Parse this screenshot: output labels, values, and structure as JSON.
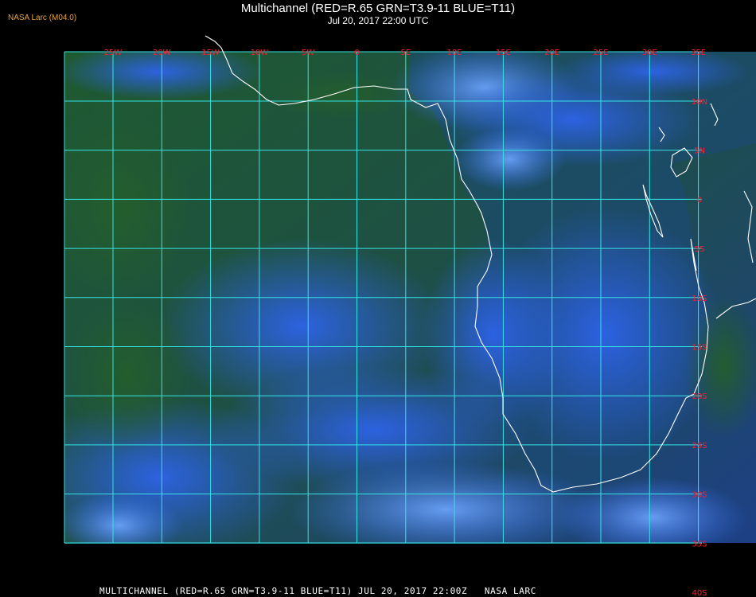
{
  "header": {
    "brand": "NASA Larc (M04.0)",
    "title": "Multichannel (RED=R.65 GRN=T3.9-11 BLUE=T11)",
    "subtitle": "Jul 20, 2017 22:00 UTC"
  },
  "map": {
    "longitude_labels": [
      "25W",
      "20W",
      "15W",
      "10W",
      "5W",
      "0",
      "5E",
      "10E",
      "15E",
      "20E",
      "25E",
      "30E",
      "35E"
    ],
    "latitude_labels": [
      "10N",
      "5N",
      "0",
      "5S",
      "10S",
      "15S",
      "20S",
      "25S",
      "30S",
      "35S",
      "40S"
    ],
    "grid_color": "#33e5e5",
    "label_color": "#ff1f2e",
    "coastline_color": "#ffffff",
    "imagery_colors": {
      "ocean_green": "#1f5a2c",
      "cloud_blue": "#2a58e0",
      "deep_blue": "#1a3fb0",
      "bright_cloud": "#6aa8ff"
    }
  },
  "footer": {
    "caption": "MULTICHANNEL (RED=R.65 GRN=T3.9-11 BLUE=T11) JUL 20, 2017 22:00Z   NASA LARC"
  }
}
